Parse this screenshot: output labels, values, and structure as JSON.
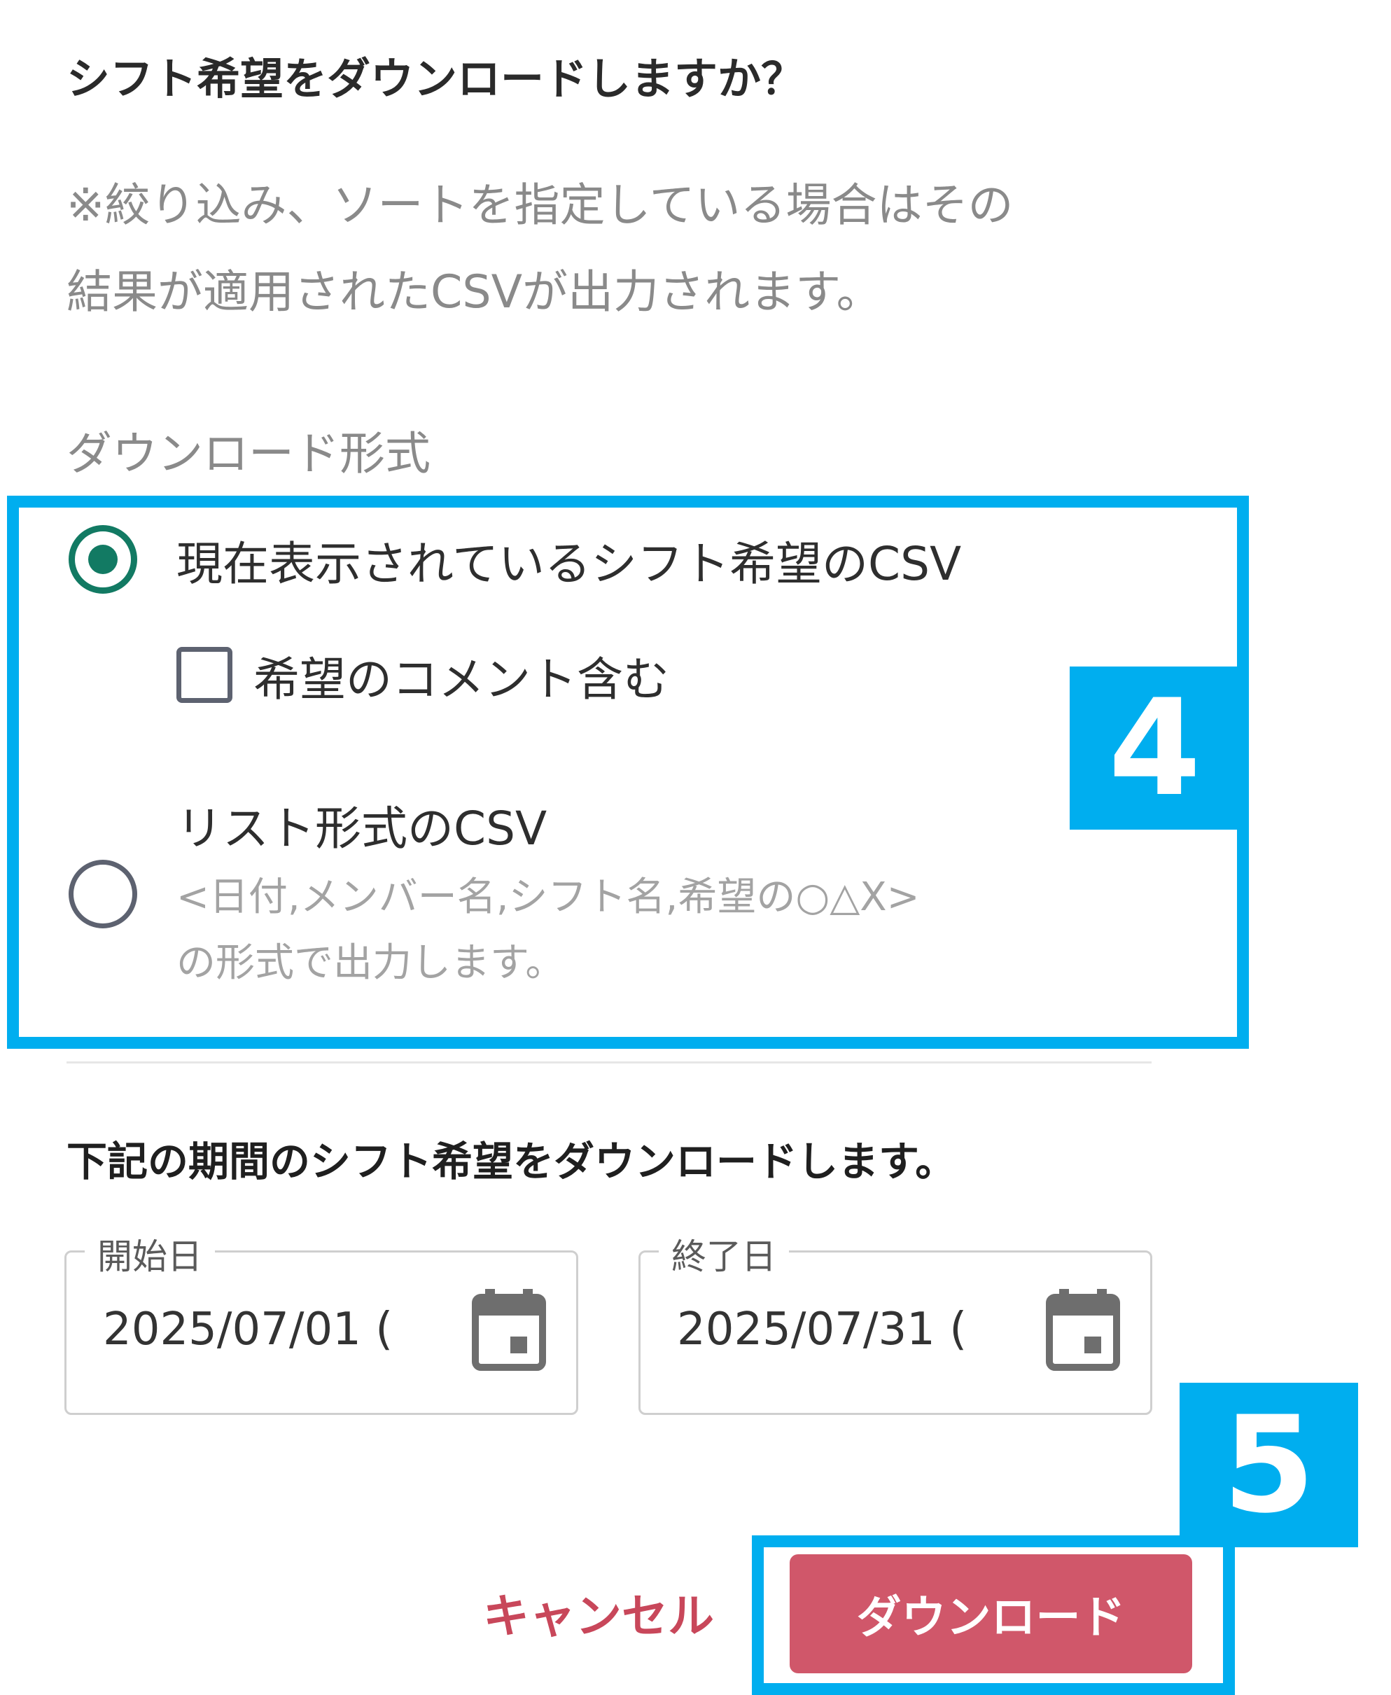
{
  "dialog": {
    "title": "シフト希望をダウンロードしますか？",
    "note_line1": "※絞り込み、ソートを指定している場合はその",
    "note_line2": "結果が適用されたCSVが出力されます。",
    "format_label": "ダウンロード形式",
    "options": [
      {
        "label": "現在表示されているシフト希望のCSV",
        "selected": true
      },
      {
        "label": "リスト形式のCSV",
        "selected": false,
        "description_line1": "<日付,メンバー名,シフト名,希望の○△X>",
        "description_line2": "の形式で出力します。"
      }
    ],
    "comment_checkbox": {
      "label": "希望のコメント含む",
      "checked": false
    },
    "period_heading": "下記の期間のシフト希望をダウンロードします。",
    "start_date": {
      "label": "開始日",
      "value": "2025/07/01 ("
    },
    "end_date": {
      "label": "終了日",
      "value": "2025/07/31 ("
    },
    "cancel_label": "キャンセル",
    "download_label": "ダウンロード"
  },
  "annotations": {
    "step4": "4",
    "step5": "5"
  },
  "colors": {
    "accent": "#127a63",
    "highlight": "#00aeef",
    "danger": "#d0576a"
  }
}
